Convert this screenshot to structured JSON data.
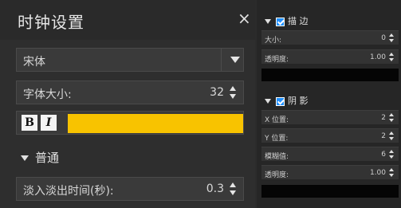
{
  "clock_settings": {
    "title": "时钟设置",
    "close_glyph": "×",
    "font_family": "宋体",
    "font_size_label": "字体大小:",
    "font_size_value": "32",
    "bold_label": "B",
    "italic_label": "I",
    "text_color": "#f8c300",
    "section_general": "普通",
    "fade_label": "淡入淡出时间(秒):",
    "fade_value": "0.3"
  },
  "outline": {
    "title": "描 边",
    "enabled": true,
    "size_label": "大小:",
    "size_value": "0",
    "opacity_label": "透明度:",
    "opacity_value": "1.00",
    "color": "#000000"
  },
  "shadow": {
    "title": "阴 影",
    "enabled": true,
    "x_label": "X 位置:",
    "x_value": "2",
    "y_label": "Y 位置:",
    "y_value": "2",
    "blur_label": "模糊值:",
    "blur_value": "6",
    "opacity_label": "透明度:",
    "opacity_value": "1.00",
    "color": "#000000"
  }
}
